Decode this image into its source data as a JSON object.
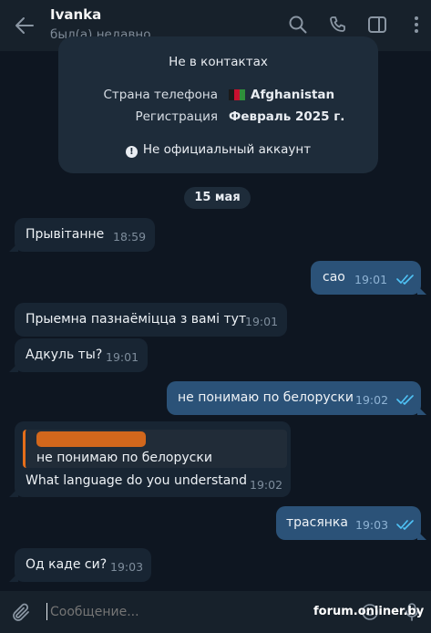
{
  "header": {
    "title": "Ivanka",
    "status": "был(а) недавно"
  },
  "info_card": {
    "contact_status": "Не в контактах",
    "rows": [
      {
        "label": "Страна телефона",
        "value": "Afghanistan",
        "flag": "afghanistan-flag"
      },
      {
        "label": "Регистрация",
        "value": "Февраль 2025 г."
      }
    ],
    "notice": "Не официальный аккаунт",
    "notice_icon": "exclamation-icon"
  },
  "date_separator": "15 мая",
  "messages": [
    {
      "direction": "in",
      "text": "Прывітанне",
      "time": "18:59"
    },
    {
      "direction": "out",
      "text": "сао",
      "time": "19:01",
      "read": true
    },
    {
      "direction": "in",
      "text": "Прыемна пазнаёміцца з вамі тут",
      "time": "19:01"
    },
    {
      "direction": "in",
      "text": "Адкуль ты?",
      "time": "19:01"
    },
    {
      "direction": "out",
      "text": "не понимаю по белоруски",
      "time": "19:02",
      "read": true
    },
    {
      "direction": "in",
      "text": "What language do you understand",
      "time": "19:02",
      "reply_to": "не понимаю по белоруски",
      "reply_author_redacted": true
    },
    {
      "direction": "out",
      "text": "трасянка",
      "time": "19:03",
      "read": true
    },
    {
      "direction": "in",
      "text": "Од каде си?",
      "time": "19:03"
    }
  ],
  "composer": {
    "placeholder": "Сообщение..."
  },
  "watermark": "forum.onliner.by",
  "colors": {
    "background": "#0e1621",
    "header": "#17212b",
    "incoming_bubble": "#182533",
    "outgoing_bubble": "#2b5278",
    "read_check": "#4fc3f7",
    "redaction": "#e56e1a"
  },
  "icons": {
    "back": "arrow-left-icon",
    "search": "search-icon",
    "call": "phone-icon",
    "sidebar": "sidebar-toggle-icon",
    "menu": "more-vertical-icon",
    "attach": "paperclip-icon",
    "emoji": "emoji-icon",
    "voice": "microphone-icon"
  }
}
